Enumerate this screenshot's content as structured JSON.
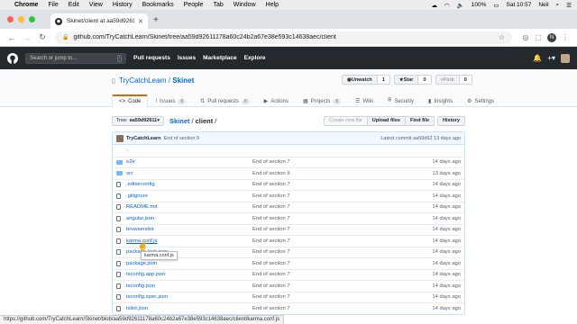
{
  "menubar": {
    "app": "Chrome",
    "items": [
      "File",
      "Edit",
      "View",
      "History",
      "Bookmarks",
      "People",
      "Tab",
      "Window",
      "Help"
    ],
    "battery": "100%",
    "datetime": "Sat 10:57",
    "user": "Neil"
  },
  "browser": {
    "tab_title": "Skinet/client at aa59d92611178a",
    "url": "github.com/TryCatchLearn/Skinet/tree/aa59d92611178a60c24b2a67e38e593c14638aec/client",
    "profile_initial": "N"
  },
  "github": {
    "search_placeholder": "Search or jump to...",
    "search_key": "/",
    "nav": [
      "Pull requests",
      "Issues",
      "Marketplace",
      "Explore"
    ]
  },
  "repo": {
    "owner": "TryCatchLearn",
    "name": "Skinet",
    "watch": {
      "label": "Unwatch",
      "count": "1"
    },
    "star": {
      "label": "Star",
      "count": "0"
    },
    "fork": {
      "label": "Fork",
      "count": "0"
    },
    "tabs": [
      {
        "label": "Code",
        "icon": "<>",
        "badge": ""
      },
      {
        "label": "Issues",
        "icon": "!",
        "badge": "0"
      },
      {
        "label": "Pull requests",
        "icon": "⇅",
        "badge": "0"
      },
      {
        "label": "Actions",
        "icon": "▶",
        "badge": ""
      },
      {
        "label": "Projects",
        "icon": "▦",
        "badge": "0"
      },
      {
        "label": "Wiki",
        "icon": "☰",
        "badge": ""
      },
      {
        "label": "Security",
        "icon": "⛨",
        "badge": ""
      },
      {
        "label": "Insights",
        "icon": "▮",
        "badge": ""
      },
      {
        "label": "Settings",
        "icon": "⚙",
        "badge": ""
      }
    ]
  },
  "filenav": {
    "branch_prefix": "Tree:",
    "branch": "aa59d92611",
    "path_repo": "Skinet",
    "path_dir": "client",
    "buttons": [
      "Create new file",
      "Upload files",
      "Find file",
      "History"
    ]
  },
  "commit": {
    "author": "TryCatchLearn",
    "message": "End of section 9",
    "latest": "Latest commit aa59d92 13 days ago"
  },
  "files": [
    {
      "type": "up",
      "name": "..",
      "message": "",
      "age": ""
    },
    {
      "type": "dir",
      "name": "e2e",
      "message": "End of section 7",
      "age": "14 days ago"
    },
    {
      "type": "dir",
      "name": "src",
      "message": "End of section 9",
      "age": "13 days ago"
    },
    {
      "type": "file",
      "name": ".editorconfig",
      "message": "End of section 7",
      "age": "14 days ago"
    },
    {
      "type": "file",
      "name": ".gitignore",
      "message": "End of section 7",
      "age": "14 days ago"
    },
    {
      "type": "file",
      "name": "README.md",
      "message": "End of section 7",
      "age": "14 days ago"
    },
    {
      "type": "file",
      "name": "angular.json",
      "message": "End of section 7",
      "age": "14 days ago"
    },
    {
      "type": "file",
      "name": "browserslist",
      "message": "End of section 7",
      "age": "14 days ago"
    },
    {
      "type": "file",
      "name": "karma.conf.js",
      "message": "End of section 7",
      "age": "14 days ago"
    },
    {
      "type": "file",
      "name": "package-lock.json",
      "message": "End of section 7",
      "age": "14 days ago"
    },
    {
      "type": "file",
      "name": "package.json",
      "message": "End of section 7",
      "age": "14 days ago"
    },
    {
      "type": "file",
      "name": "tsconfig.app.json",
      "message": "End of section 7",
      "age": "14 days ago"
    },
    {
      "type": "file",
      "name": "tsconfig.json",
      "message": "End of section 7",
      "age": "14 days ago"
    },
    {
      "type": "file",
      "name": "tsconfig.spec.json",
      "message": "End of section 7",
      "age": "14 days ago"
    },
    {
      "type": "file",
      "name": "tslint.json",
      "message": "End of section 7",
      "age": "14 days ago"
    }
  ],
  "tooltip": "karma.conf.js",
  "status_url": "https://github.com/TryCatchLearn/Skinet/blob/aa59d92611178a60c24b2a67e38e593c14638aec/client/karma.conf.js"
}
